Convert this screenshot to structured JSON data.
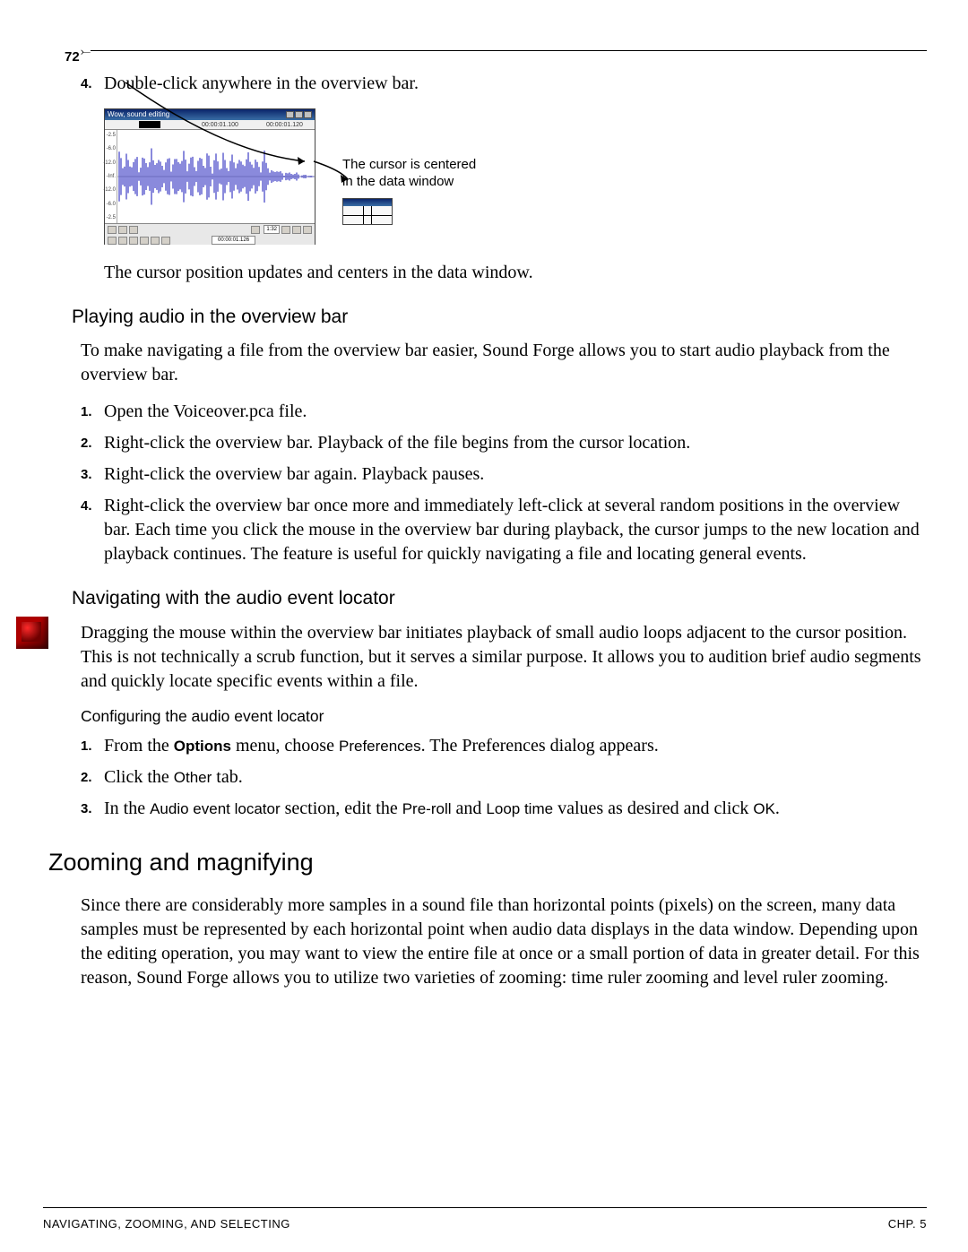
{
  "page_number": "72",
  "step4_top": "Double-click anywhere in the overview bar.",
  "screenshot": {
    "title": "Wow, sound editing",
    "ruler": {
      "t1": "00:00:01.100",
      "t2": "00:00:01.120"
    },
    "y_ticks": [
      "-2.5",
      "-6.0",
      "-12.0",
      "-Inf.",
      "-12.0",
      "-6.0",
      "-2.5"
    ],
    "status": {
      "zoom": "1:32",
      "time": "00:00:01.126"
    }
  },
  "callout": {
    "line1": "The cursor is centered",
    "line2": "in the data window"
  },
  "caption_below": "The cursor position updates and centers in the data window.",
  "sec_play": {
    "heading": "Playing audio in the overview bar",
    "intro": "To make navigating a file from the overview bar easier, Sound Forge allows you to start audio playback from the overview bar.",
    "steps": [
      "Open the Voiceover.pca file.",
      "Right-click the overview bar. Playback of the file begins from the cursor location.",
      "Right-click the overview bar again. Playback pauses.",
      "Right-click the overview bar once more and immediately left-click at several random positions in the overview bar. Each time you click the mouse in the overview bar during playback, the cursor jumps to the new location and playback continues. The feature is useful for quickly navigating a file and locating general events."
    ]
  },
  "sec_nav": {
    "heading": "Navigating with the audio event locator",
    "body": "Dragging the mouse within the overview bar initiates playback of small audio loops adjacent to the cursor position. This is not technically a scrub function, but it serves a similar purpose. It allows you to audition brief audio segments and quickly locate specific events within a file.",
    "sub_heading": "Configuring the audio event locator",
    "step1": {
      "pre": "From the ",
      "menu": "Options",
      "mid": " menu, choose ",
      "item": "Preferences",
      "post": ". The Preferences dialog appears."
    },
    "step2": {
      "pre": "Click the ",
      "tab": "Other",
      "post": " tab."
    },
    "step3": {
      "pre": "In the ",
      "sect": "Audio event locator",
      "mid": " section, edit the ",
      "f1": "Pre-roll",
      "and": " and ",
      "f2": "Loop time",
      "mid2": " values as desired and click ",
      "ok": "OK",
      "post": "."
    }
  },
  "zoom": {
    "heading": "Zooming and magnifying",
    "body": "Since there are considerably more samples in a sound file than horizontal points (pixels) on the screen, many data samples must be represented by each horizontal point when audio data displays in the data window. Depending upon the editing operation, you may want to view the entire file at once or a small portion of data in greater detail. For this reason, Sound Forge allows you to utilize two varieties of zooming: time ruler zooming and level ruler zooming."
  },
  "footer": {
    "left": "NAVIGATING, ZOOMING, AND SELECTING",
    "right": "CHP. 5"
  }
}
